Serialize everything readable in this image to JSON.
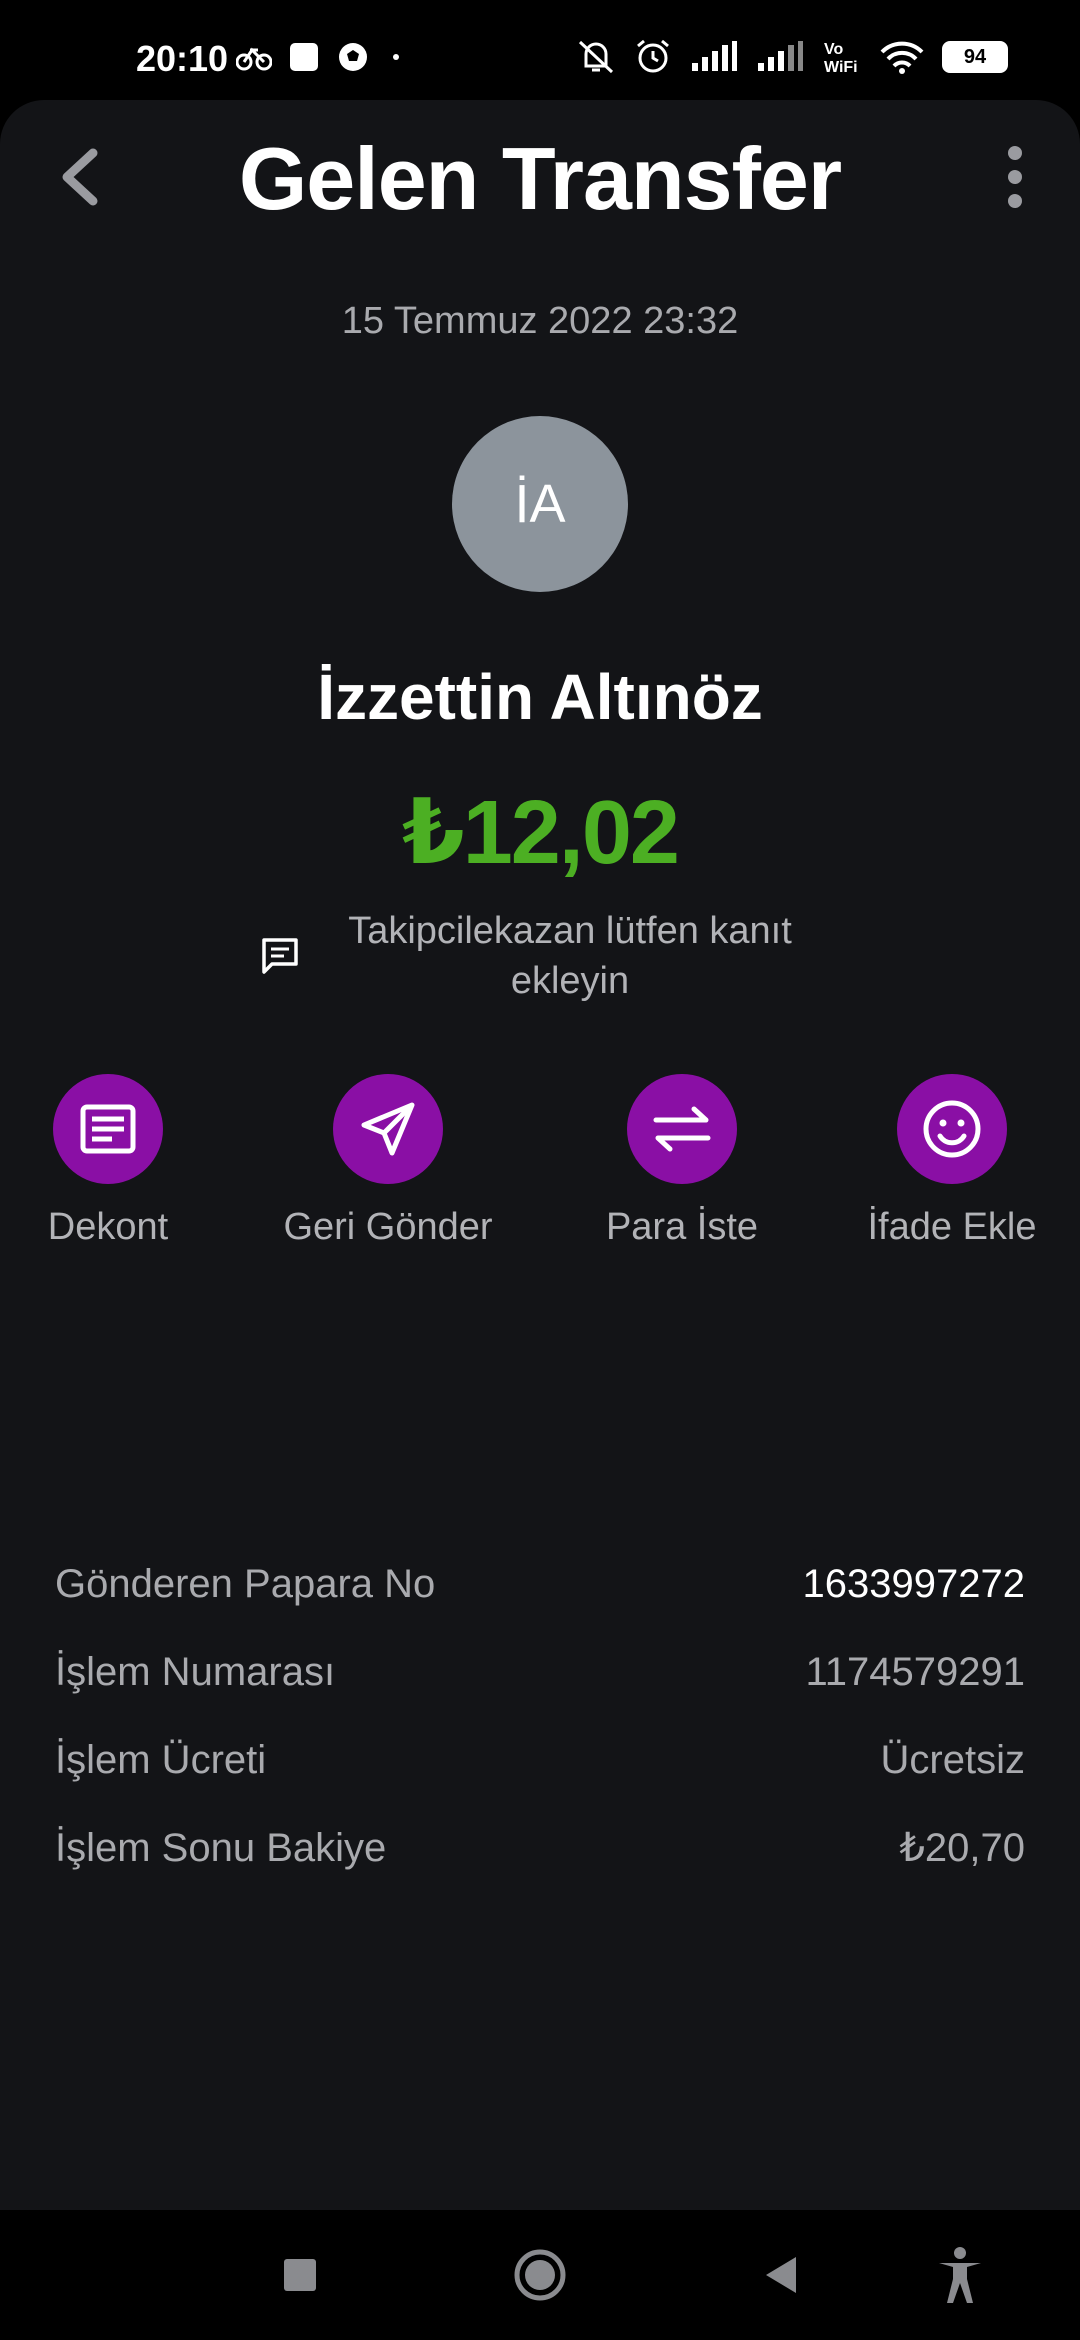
{
  "status_bar": {
    "time": "20:10",
    "battery": "94",
    "left_icons": [
      "bike-icon",
      "square-app-icon",
      "soccer-ball-icon",
      "dot-icon"
    ],
    "right_icons": [
      "muted-bell-icon",
      "alarm-icon",
      "signal-icon",
      "signal-icon",
      "vowifi-icon",
      "wifi-icon",
      "battery-icon"
    ]
  },
  "header": {
    "title": "Gelen Transfer"
  },
  "transaction": {
    "date": "15 Temmuz 2022 23:32",
    "avatar_initials": "İA",
    "sender_name": "İzzettin Altınöz",
    "amount": "₺12,02",
    "note": "Takipcilekazan lütfen kanıt ekleyin",
    "amount_color": "#4caf23"
  },
  "actions": [
    {
      "label": "Dekont",
      "icon": "receipt-icon"
    },
    {
      "label": "Geri Gönder",
      "icon": "send-icon"
    },
    {
      "label": "Para İste",
      "icon": "swap-icon"
    },
    {
      "label": "İfade Ekle",
      "icon": "smiley-icon"
    }
  ],
  "details": [
    {
      "label": "Gönderen Papara No",
      "value": "1633997272"
    },
    {
      "label": "İşlem Numarası",
      "value": "1174579291"
    },
    {
      "label": "İşlem Ücreti",
      "value": "Ücretsiz"
    },
    {
      "label": "İşlem Sonu Bakiye",
      "value": "₺20,70"
    }
  ],
  "nav_bar": {
    "icons": [
      "recents-icon",
      "home-icon",
      "back-icon",
      "accessibility-icon"
    ]
  },
  "colors": {
    "background": "#131417",
    "accent": "#8a0fa5",
    "avatar": "#8c949c"
  }
}
